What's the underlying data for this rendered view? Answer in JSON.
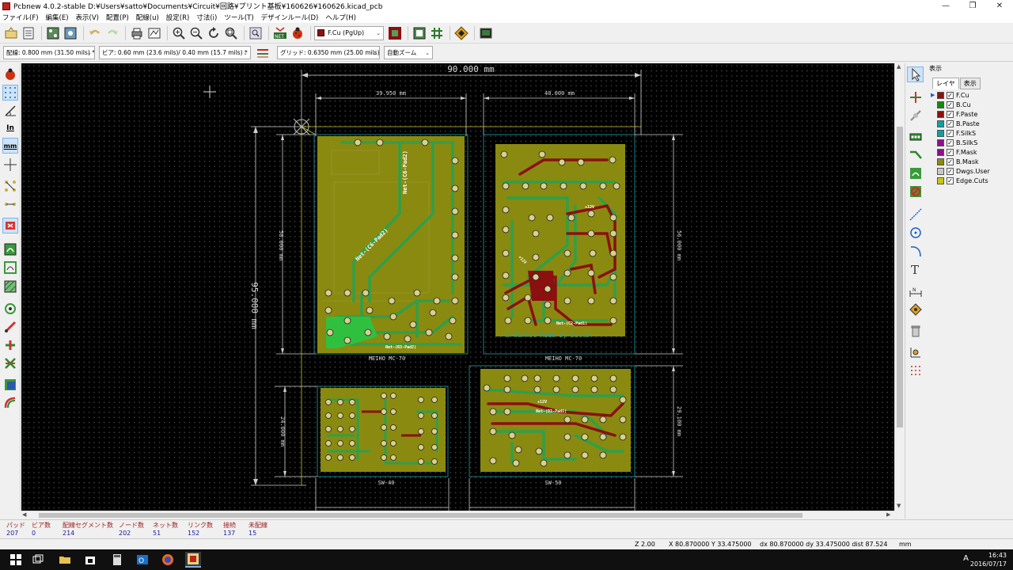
{
  "window": {
    "title": "Pcbnew 4.0.2-stable D:¥Users¥satto¥Documents¥Circuit¥回路¥プリント基板¥160626¥160626.kicad_pcb",
    "minimize": "—",
    "maximize": "❐",
    "close": "✕"
  },
  "menu": [
    "ファイル(F)",
    "編集(E)",
    "表示(V)",
    "配置(P)",
    "配線(u)",
    "設定(R)",
    "寸法(i)",
    "ツール(T)",
    "デザインルール(D)",
    "ヘルプ(H)"
  ],
  "toolbar": {
    "active_layer": "F.Cu (PgUp)"
  },
  "toolbar2": {
    "track_width": "配線: 0.800 mm (31.50 mils) *",
    "via_size": "ビア: 0.60 mm (23.6 mils)/ 0.40 mm (15.7 mils) *",
    "grid": "グリッド: 0.6350 mm (25.00 mils)",
    "zoom": "自動ズーム"
  },
  "lefttb": {
    "inch_label": "In",
    "mm_label": "mm"
  },
  "board": {
    "dim_total_width": "90.000 mm",
    "dim_left_width": "39.950 mm",
    "dim_right_width": "40.000 mm",
    "dim_total_height": "95.000 mm",
    "dim_left_height": "58.000 mm",
    "dim_right_height": "56.000 mm",
    "dim_bottom_left_height": "24.000 mm",
    "dim_bottom_right_height": "29.100 mm",
    "label_top_left": "MEIHO MC-70",
    "label_top_right": "MEIHO MC-70",
    "label_bottom_left": "SW-40",
    "label_bottom_right": "SW-50",
    "silk_credit": "& Winkel Made by Satto",
    "net_labels": {
      "tl_1": "Net-(C6-Pad2)",
      "tl_2": "Net-(C6-Pad2)",
      "tl_3": "Net-(R3-Pad2)",
      "tr_1": "Net-(C2-Pad1)",
      "tr_2": "+12V",
      "tr_3": "+12V",
      "br_1": "Net-(D3-Pad1)",
      "br_2": "+12V"
    }
  },
  "rightpanel": {
    "caption": "表示",
    "tab_layers": "レイヤ",
    "tab_render": "表示",
    "layers": [
      {
        "name": "F.Cu",
        "color": "#8b1010",
        "active": true
      },
      {
        "name": "B.Cu",
        "color": "#108b10",
        "active": false
      },
      {
        "name": "F.Paste",
        "color": "#8b1010",
        "active": false
      },
      {
        "name": "B.Paste",
        "color": "#10a0a0",
        "active": false
      },
      {
        "name": "F.SilkS",
        "color": "#10a0a0",
        "active": false
      },
      {
        "name": "B.SilkS",
        "color": "#8b108b",
        "active": false
      },
      {
        "name": "F.Mask",
        "color": "#8b108b",
        "active": false
      },
      {
        "name": "B.Mask",
        "color": "#8b8b10",
        "active": false
      },
      {
        "name": "Dwgs.User",
        "color": "#c8c8c8",
        "active": false
      },
      {
        "name": "Edge.Cuts",
        "color": "#c8c810",
        "active": false
      }
    ]
  },
  "messages": [
    {
      "h": "パッド",
      "v": "207"
    },
    {
      "h": "ビア数",
      "v": "0"
    },
    {
      "h": "配線セグメント数",
      "v": "214"
    },
    {
      "h": "ノード数",
      "v": "202"
    },
    {
      "h": "ネット数",
      "v": "51"
    },
    {
      "h": "リンク数",
      "v": "152"
    },
    {
      "h": "接続",
      "v": "137"
    },
    {
      "h": "未配線",
      "v": "15"
    }
  ],
  "status": {
    "zoom": "Z 2.00",
    "xy": "X 80.870000  Y 33.475000",
    "dxdy": "dx 80.870000  dy 33.475000  dist 87.524",
    "units": "mm"
  },
  "taskbar": {
    "time": "16:43",
    "date": "2016/07/17",
    "ime": "A"
  }
}
